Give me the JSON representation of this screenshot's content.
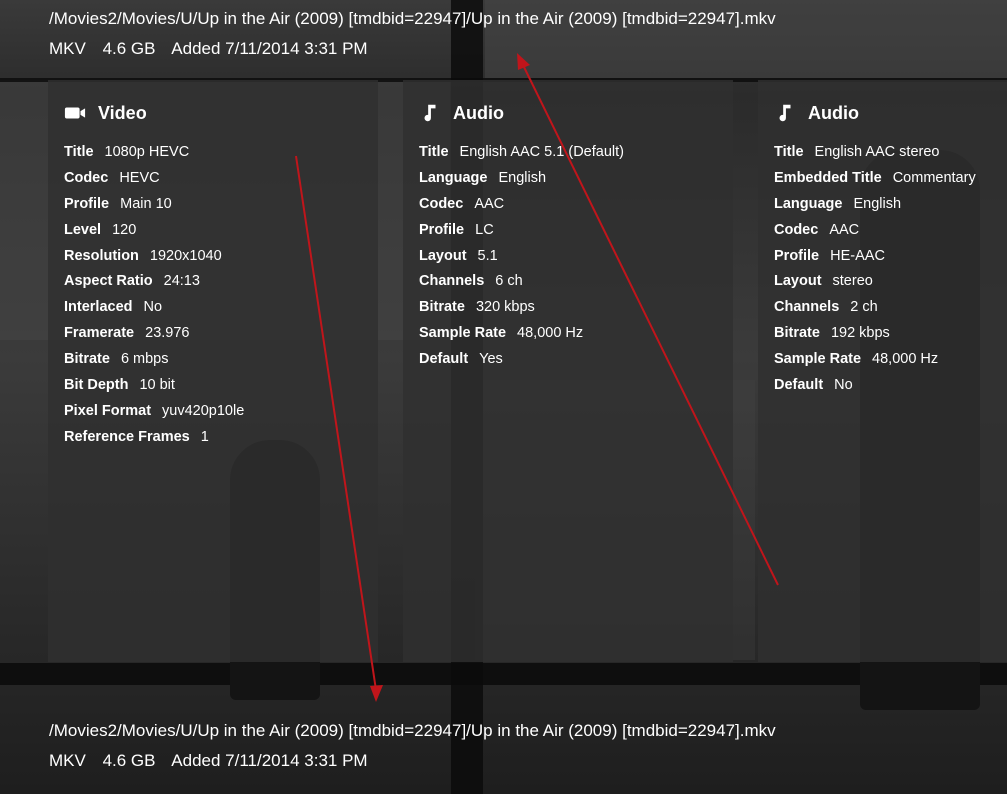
{
  "file_top": {
    "path": "/Movies2/Movies/U/Up in the Air (2009) [tmdbid=22947]/Up in the Air (2009) [tmdbid=22947].mkv",
    "container": "MKV",
    "size": "4.6 GB",
    "added": "Added 7/11/2014 3:31 PM"
  },
  "file_bottom": {
    "path": "/Movies2/Movies/U/Up in the Air (2009) [tmdbid=22947]/Up in the Air (2009) [tmdbid=22947].mkv",
    "container": "MKV",
    "size": "4.6 GB",
    "added": "Added 7/11/2014 3:31 PM"
  },
  "panels": [
    {
      "title": "Video",
      "icon": "video-camera-icon",
      "rows": [
        {
          "k": "Title",
          "v": "1080p HEVC"
        },
        {
          "k": "Codec",
          "v": "HEVC"
        },
        {
          "k": "Profile",
          "v": "Main 10"
        },
        {
          "k": "Level",
          "v": "120"
        },
        {
          "k": "Resolution",
          "v": "1920x1040"
        },
        {
          "k": "Aspect Ratio",
          "v": "24:13"
        },
        {
          "k": "Interlaced",
          "v": "No"
        },
        {
          "k": "Framerate",
          "v": "23.976"
        },
        {
          "k": "Bitrate",
          "v": "6 mbps"
        },
        {
          "k": "Bit Depth",
          "v": "10 bit"
        },
        {
          "k": "Pixel Format",
          "v": "yuv420p10le"
        },
        {
          "k": "Reference Frames",
          "v": "1"
        }
      ]
    },
    {
      "title": "Audio",
      "icon": "music-note-icon",
      "rows": [
        {
          "k": "Title",
          "v": "English AAC 5.1 (Default)"
        },
        {
          "k": "Language",
          "v": "English"
        },
        {
          "k": "Codec",
          "v": "AAC"
        },
        {
          "k": "Profile",
          "v": "LC"
        },
        {
          "k": "Layout",
          "v": "5.1"
        },
        {
          "k": "Channels",
          "v": "6 ch"
        },
        {
          "k": "Bitrate",
          "v": "320 kbps"
        },
        {
          "k": "Sample Rate",
          "v": "48,000 Hz"
        },
        {
          "k": "Default",
          "v": "Yes"
        }
      ]
    },
    {
      "title": "Audio",
      "icon": "music-note-icon",
      "rows": [
        {
          "k": "Title",
          "v": "English AAC stereo"
        },
        {
          "k": "Embedded Title",
          "v": "Commentary"
        },
        {
          "k": "Language",
          "v": "English"
        },
        {
          "k": "Codec",
          "v": "AAC"
        },
        {
          "k": "Profile",
          "v": "HE-AAC"
        },
        {
          "k": "Layout",
          "v": "stereo"
        },
        {
          "k": "Channels",
          "v": "2 ch"
        },
        {
          "k": "Bitrate",
          "v": "192 kbps"
        },
        {
          "k": "Sample Rate",
          "v": "48,000 Hz"
        },
        {
          "k": "Default",
          "v": "No"
        }
      ]
    }
  ],
  "colors": {
    "annotation_arrow": "#c0151b",
    "panel_bg": "#303030",
    "text": "#ffffff"
  }
}
